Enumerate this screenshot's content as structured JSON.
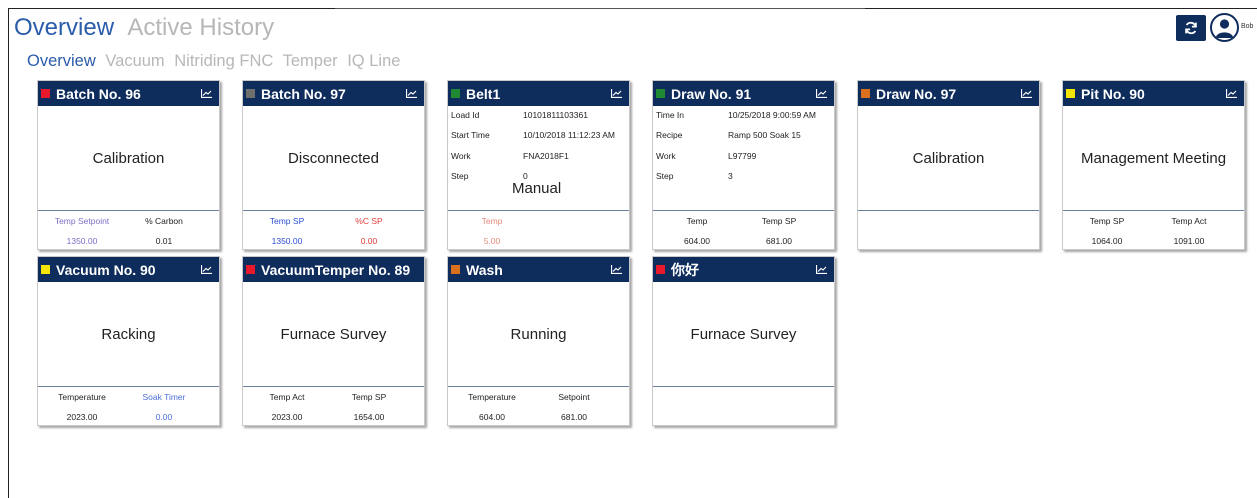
{
  "header": {
    "tabs": [
      {
        "label": "Overview",
        "active": true
      },
      {
        "label": "Active History",
        "active": false
      }
    ]
  },
  "subtabs": [
    {
      "label": "Overview",
      "active": true
    },
    {
      "label": "Vacuum",
      "active": false
    },
    {
      "label": "Nitriding FNC",
      "active": false
    },
    {
      "label": "Temper",
      "active": false
    },
    {
      "label": "IQ Line",
      "active": false
    }
  ],
  "user": {
    "name": "Bob",
    "refresh_icon": "refresh-icon",
    "avatar_icon": "user-icon"
  },
  "colors": {
    "navy": "#0e2c5c",
    "red": "#e8192c",
    "gray": "#6f6f6f",
    "green": "#1f8a33",
    "orange": "#d9701e",
    "yellow": "#f5e400",
    "purple_label": "#7b6fc8",
    "blue_label": "#2c4fd8",
    "red_label": "#e23b3b",
    "salmon_label": "#e58a7a"
  },
  "cards": [
    {
      "title": "Batch No. 96",
      "status": "Calibration",
      "foot": [
        {
          "label": "Temp Setpoint",
          "value": "1350.00"
        },
        {
          "label": "% Carbon",
          "value": "0.01"
        }
      ]
    },
    {
      "title": "Batch No. 97",
      "status": "Disconnected",
      "foot": [
        {
          "label": "Temp SP",
          "value": "1350.00"
        },
        {
          "label": "%C SP",
          "value": "0.00"
        }
      ]
    },
    {
      "title": "Belt1",
      "status": "Manual",
      "fields": [
        {
          "k": "Load Id",
          "v": "10101811103361"
        },
        {
          "k": "Start Time",
          "v": "10/10/2018 11:12:23 AM"
        },
        {
          "k": "Work",
          "v": "FNA2018F1"
        },
        {
          "k": "Step",
          "v": "0"
        }
      ],
      "foot": [
        {
          "label": "Temp",
          "value": "5.00"
        }
      ]
    },
    {
      "title": "Draw No. 91",
      "status": "",
      "fields": [
        {
          "k": "Time In",
          "v": "10/25/2018 9:00:59 AM"
        },
        {
          "k": "Recipe",
          "v": "Ramp 500 Soak 15"
        },
        {
          "k": "Work",
          "v": "L97799"
        },
        {
          "k": "Step",
          "v": "3"
        }
      ],
      "foot": [
        {
          "label": "Temp",
          "value": "604.00"
        },
        {
          "label": "Temp SP",
          "value": "681.00"
        }
      ]
    },
    {
      "title": "Draw No. 97",
      "status": "Calibration",
      "foot": []
    },
    {
      "title": "Pit No. 90",
      "status": "Management Meeting",
      "foot": [
        {
          "label": "Temp SP",
          "value": "1064.00"
        },
        {
          "label": "Temp Act",
          "value": "1091.00"
        }
      ]
    },
    {
      "title": "Vacuum No. 90",
      "status": "Racking",
      "foot": [
        {
          "label": "Temperature",
          "value": "2023.00"
        },
        {
          "label": "Soak Timer",
          "value": "0.00"
        }
      ]
    },
    {
      "title": "VacuumTemper No. 89",
      "status": "Furnace Survey",
      "foot": [
        {
          "label": "Temp Act",
          "value": "2023.00"
        },
        {
          "label": "Temp SP",
          "value": "1654.00"
        }
      ]
    },
    {
      "title": "Wash",
      "status": "Running",
      "foot": [
        {
          "label": "Temperature",
          "value": "604.00"
        },
        {
          "label": "Setpoint",
          "value": "681.00"
        }
      ]
    },
    {
      "title": "你好",
      "status": "Furnace Survey",
      "foot": []
    }
  ]
}
